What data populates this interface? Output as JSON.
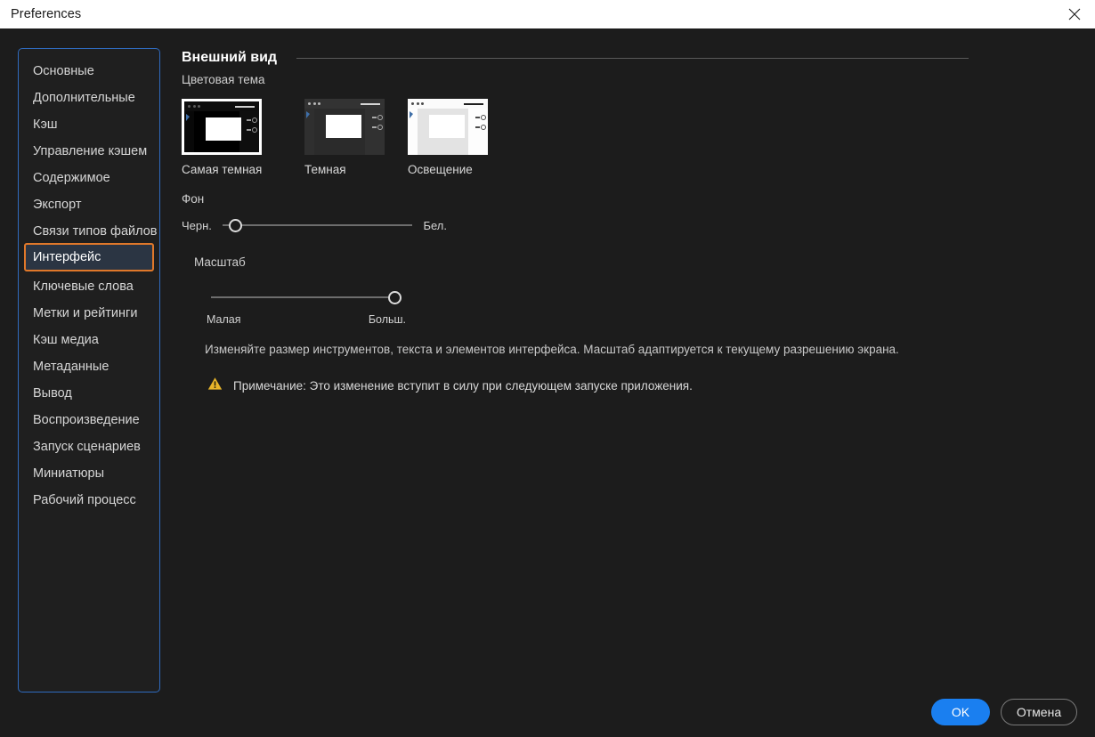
{
  "window": {
    "title": "Preferences",
    "close_icon": "close-icon"
  },
  "sidebar": {
    "items": [
      {
        "label": "Основные",
        "selected": false
      },
      {
        "label": "Дополнительные",
        "selected": false
      },
      {
        "label": "Кэш",
        "selected": false
      },
      {
        "label": "Управление кэшем",
        "selected": false
      },
      {
        "label": "Содержимое",
        "selected": false
      },
      {
        "label": "Экспорт",
        "selected": false
      },
      {
        "label": "Связи типов файлов",
        "selected": false
      },
      {
        "label": "Интерфейс",
        "selected": true
      },
      {
        "label": "Ключевые слова",
        "selected": false
      },
      {
        "label": "Метки и рейтинги",
        "selected": false
      },
      {
        "label": "Кэш медиа",
        "selected": false
      },
      {
        "label": "Метаданные",
        "selected": false
      },
      {
        "label": "Вывод",
        "selected": false
      },
      {
        "label": "Воспроизведение",
        "selected": false
      },
      {
        "label": "Запуск сценариев",
        "selected": false
      },
      {
        "label": "Миниатюры",
        "selected": false
      },
      {
        "label": "Рабочий процесс",
        "selected": false
      }
    ]
  },
  "content": {
    "section_title": "Внешний вид",
    "color_theme_label": "Цветовая тема",
    "themes": [
      {
        "label": "Самая темная",
        "selected": true
      },
      {
        "label": "Темная",
        "selected": false
      },
      {
        "label": "Освещение",
        "selected": false
      }
    ],
    "background": {
      "label": "Фон",
      "min_label": "Черн.",
      "max_label": "Бел.",
      "value_percent": 7
    },
    "scale": {
      "label": "Масштаб",
      "min_label": "Малая",
      "max_label": "Больш.",
      "value_percent": 100
    },
    "description": "Изменяйте размер инструментов, текста и элементов интерфейса. Масштаб адаптируется к текущему разрешению экрана.",
    "note": {
      "icon": "warning-triangle-icon",
      "text": "Примечание: Это изменение вступит в силу при следующем запуске приложения.",
      "color": "#e8b52a"
    }
  },
  "footer": {
    "ok_label": "OK",
    "cancel_label": "Отмена",
    "accent_color": "#1a7ff0"
  }
}
